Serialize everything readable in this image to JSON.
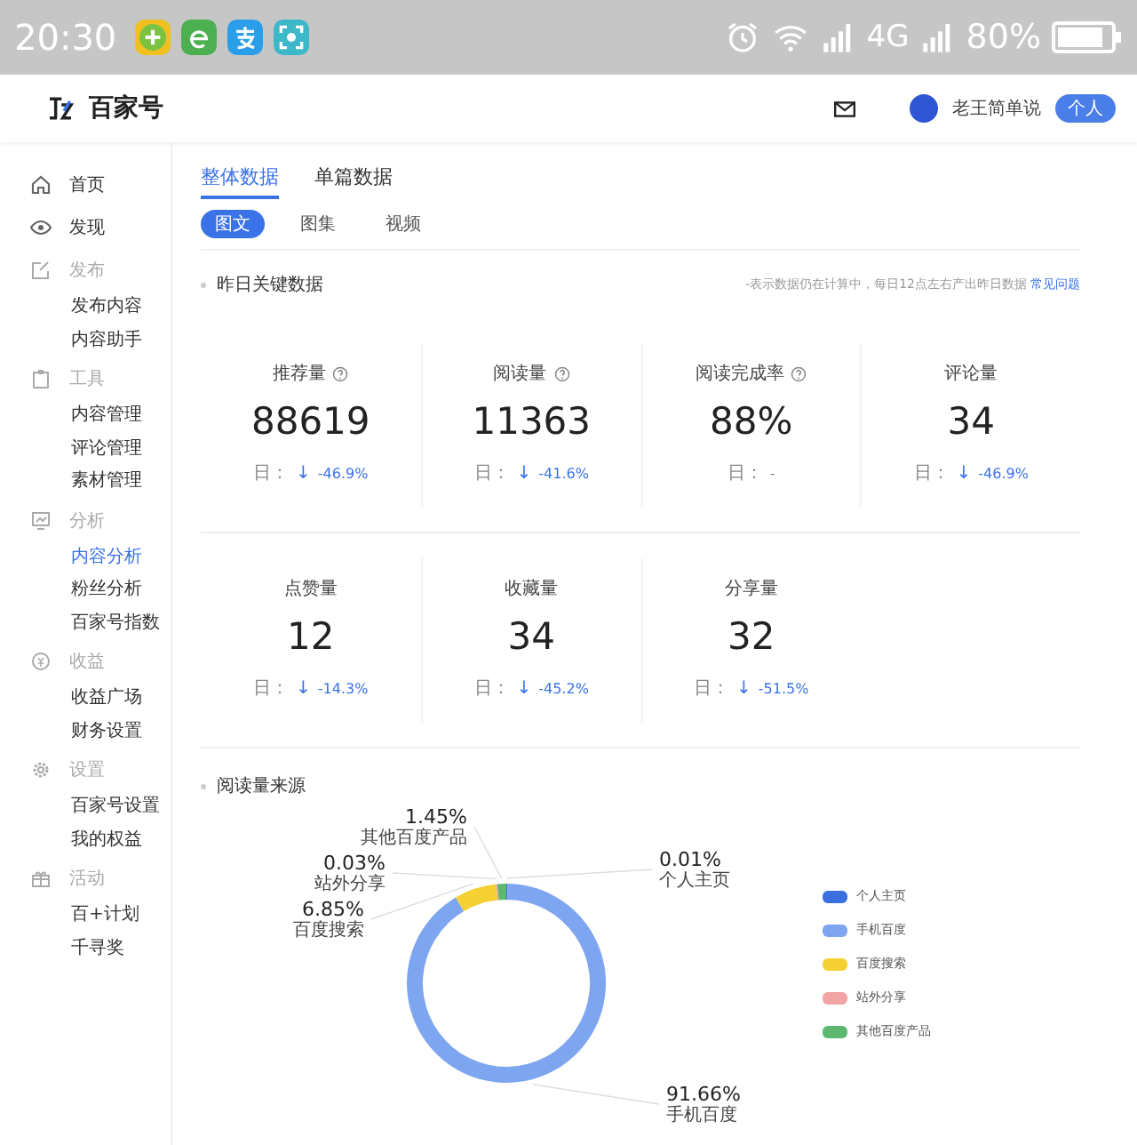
{
  "status_bar": {
    "time": "20:30",
    "network": "4G",
    "battery": "80%"
  },
  "header": {
    "logo": "百家号",
    "user": "老王简单说",
    "badge": "个人"
  },
  "sidebar": [
    {
      "kind": "link",
      "label": "首页",
      "selected": false
    },
    {
      "kind": "link",
      "label": "发现",
      "selected": false
    },
    {
      "kind": "section",
      "label": "发布",
      "children": [
        {
          "label": "发布内容",
          "selected": false
        },
        {
          "label": "内容助手",
          "selected": false
        }
      ]
    },
    {
      "kind": "section",
      "label": "工具",
      "children": [
        {
          "label": "内容管理",
          "selected": false
        },
        {
          "label": "评论管理",
          "selected": false
        },
        {
          "label": "素材管理",
          "selected": false
        }
      ]
    },
    {
      "kind": "section",
      "label": "分析",
      "children": [
        {
          "label": "内容分析",
          "selected": true
        },
        {
          "label": "粉丝分析",
          "selected": false
        },
        {
          "label": "百家号指数",
          "selected": false
        }
      ]
    },
    {
      "kind": "section",
      "label": "收益",
      "children": [
        {
          "label": "收益广场",
          "selected": false
        },
        {
          "label": "财务设置",
          "selected": false
        }
      ]
    },
    {
      "kind": "section",
      "label": "设置",
      "children": [
        {
          "label": "百家号设置",
          "selected": false
        },
        {
          "label": "我的权益",
          "selected": false
        }
      ]
    },
    {
      "kind": "section",
      "label": "活动",
      "children": [
        {
          "label": "百+计划",
          "selected": false
        },
        {
          "label": "千寻奖",
          "selected": false
        }
      ]
    }
  ],
  "tabs": [
    {
      "label": "整体数据",
      "selected": true
    },
    {
      "label": "单篇数据",
      "selected": false
    }
  ],
  "content_types": [
    {
      "label": "图文",
      "selected": true
    },
    {
      "label": "图集",
      "selected": false
    },
    {
      "label": "视频",
      "selected": false
    }
  ],
  "key_data": {
    "title": "昨日关键数据",
    "note": "-表示数据仍在计算中，每日12点左右产出昨日数据",
    "help_link": "常见问题",
    "metrics": [
      {
        "label": "推荐量",
        "help": true,
        "value": "88619",
        "prefix": "日：",
        "arrow": "↓",
        "change": "-46.9%"
      },
      {
        "label": "阅读量",
        "help": true,
        "value": "11363",
        "prefix": "日：",
        "arrow": "↓",
        "change": "-41.6%"
      },
      {
        "label": "阅读完成率",
        "help": true,
        "value": "88%",
        "prefix": "日：",
        "change": "-"
      },
      {
        "label": "评论量",
        "help": false,
        "value": "34",
        "prefix": "日：",
        "arrow": "↓",
        "change": "-46.9%"
      },
      {
        "label": "点赞量",
        "help": false,
        "value": "12",
        "prefix": "日：",
        "arrow": "↓",
        "change": "-14.3%"
      },
      {
        "label": "收藏量",
        "help": false,
        "value": "34",
        "prefix": "日：",
        "arrow": "↓",
        "change": "-45.2%"
      },
      {
        "label": "分享量",
        "help": false,
        "value": "32",
        "prefix": "日：",
        "arrow": "↓",
        "change": "-51.5%"
      }
    ]
  },
  "read_sources": {
    "title": "阅读量来源",
    "chart_data": {
      "type": "donut",
      "categories": [
        "个人主页",
        "手机百度",
        "百度搜索",
        "站外分享",
        "其他百度产品"
      ],
      "values": [
        0.01,
        91.66,
        6.85,
        0.03,
        1.45
      ],
      "value_labels": [
        "0.01%",
        "91.66%",
        "6.85%",
        "0.03%",
        "1.45%"
      ]
    },
    "legend": [
      {
        "label": "个人主页",
        "color": "#3b6fe0"
      },
      {
        "label": "手机百度",
        "color": "#7ea6f0"
      },
      {
        "label": "百度搜索",
        "color": "#f5d033"
      },
      {
        "label": "站外分享",
        "color": "#f2a3a3"
      },
      {
        "label": "其他百度产品",
        "color": "#5cb870"
      }
    ]
  }
}
